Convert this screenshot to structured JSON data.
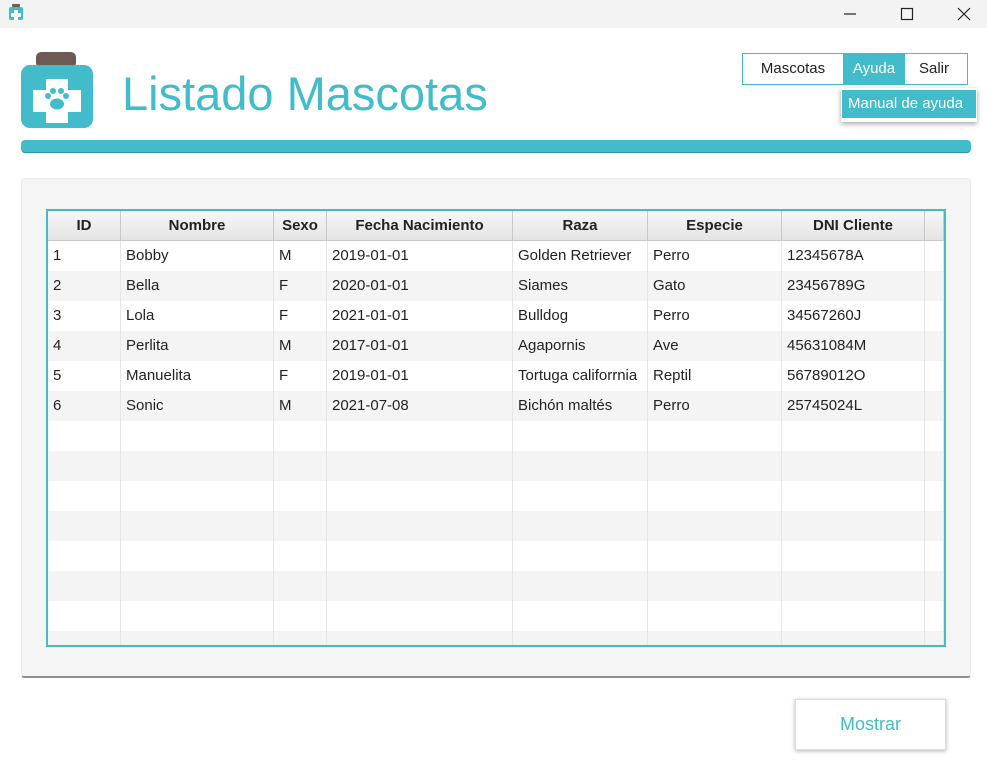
{
  "window": {
    "minimize_icon": "minimize-icon",
    "maximize_icon": "maximize-icon",
    "close_icon": "close-icon"
  },
  "header": {
    "title": "Listado Mascotas",
    "logo_icon": "pet-medicine-bottle-icon",
    "accent_color": "#42bccb"
  },
  "menu": {
    "items": [
      {
        "label": "Mascotas",
        "active": false
      },
      {
        "label": "Ayuda",
        "active": true
      },
      {
        "label": "Salir",
        "active": false
      }
    ],
    "dropdown": {
      "items": [
        {
          "label": "Manual de ayuda"
        }
      ]
    }
  },
  "table": {
    "columns": [
      "ID",
      "Nombre",
      "Sexo",
      "Fecha Nacimiento",
      "Raza",
      "Especie",
      "DNI Cliente"
    ],
    "rows": [
      [
        "1",
        "Bobby",
        "M",
        "2019-01-01",
        "Golden Retriever",
        "Perro",
        "12345678A"
      ],
      [
        "2",
        "Bella",
        "F",
        "2020-01-01",
        "Siames",
        "Gato",
        "23456789G"
      ],
      [
        "3",
        "Lola",
        "F",
        "2021-01-01",
        "Bulldog",
        "Perro",
        "34567260J"
      ],
      [
        "4",
        "Perlita",
        "M",
        "2017-01-01",
        "Agapornis",
        "Ave",
        "45631084M"
      ],
      [
        "5",
        "Manuelita",
        "F",
        "2019-01-01",
        "Tortuga califorrnia",
        "Reptil",
        "56789012O"
      ],
      [
        "6",
        "Sonic",
        "M",
        "2021-07-08",
        "Bichón maltés",
        "Perro",
        "25745024L"
      ]
    ]
  },
  "actions": {
    "mostrar_label": "Mostrar"
  }
}
